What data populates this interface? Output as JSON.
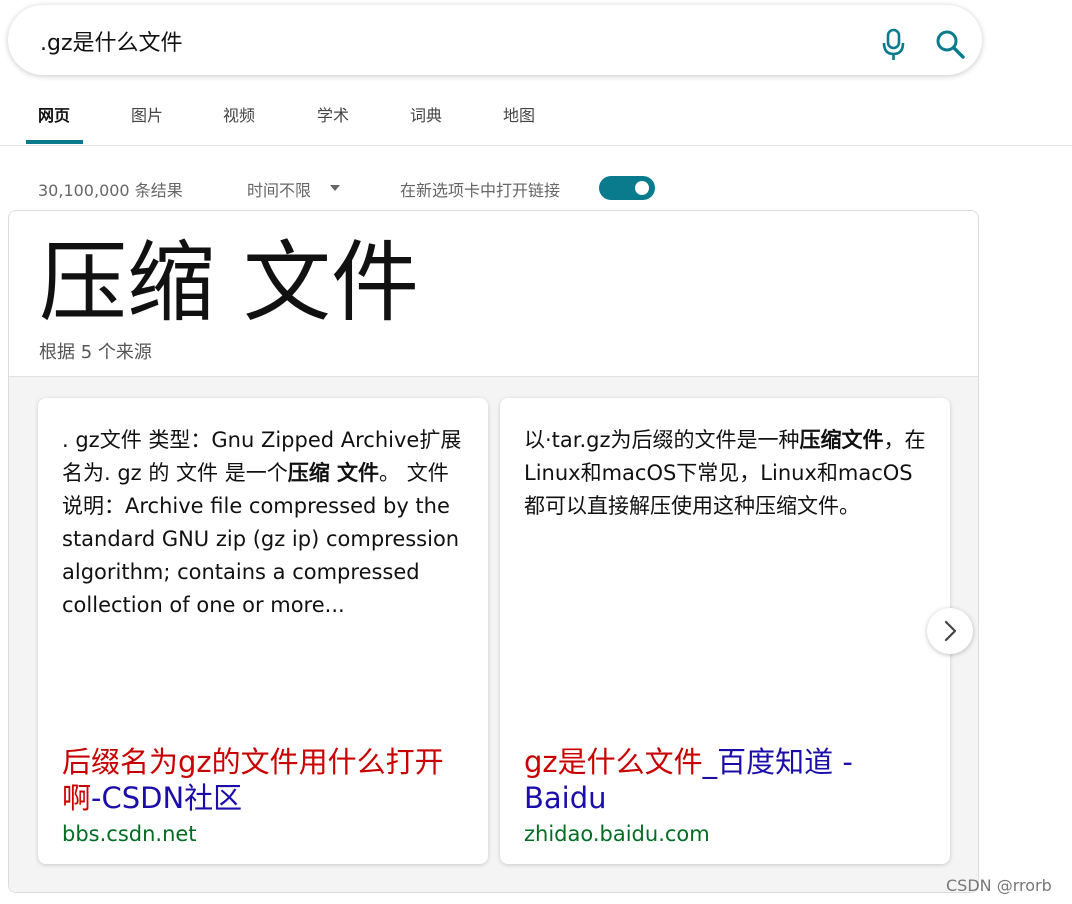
{
  "search": {
    "query": ".gz是什么文件"
  },
  "tabs": [
    {
      "label": "网页",
      "active": true
    },
    {
      "label": "图片"
    },
    {
      "label": "视频"
    },
    {
      "label": "学术"
    },
    {
      "label": "词典"
    },
    {
      "label": "地图"
    }
  ],
  "filters": {
    "result_count": "30,100,000 条结果",
    "time_filter": "时间不限",
    "open_new_tab_label": "在新选项卡中打开链接",
    "open_new_tab_enabled": true
  },
  "answer": {
    "title": "压缩 文件",
    "sources_note": "根据 5 个来源",
    "cards": [
      {
        "text_parts": [
          {
            "t": ". gz文件 类型：Gnu Zipped Archive扩展 名为. gz 的 文件 是一个",
            "bold": false
          },
          {
            "t": "压缩 文件",
            "bold": true
          },
          {
            "t": "。 文件 说明：Archive file compressed by the standard GNU zip (gz ip) compression algorithm; contains a compressed collection of one or more...",
            "bold": false
          }
        ],
        "link_red": "后缀名为gz的文件用什么打开啊",
        "link_blue": "-CSDN社区",
        "source": "bbs.csdn.net"
      },
      {
        "text_parts": [
          {
            "t": "以·tar.gz为后缀的文件是一种",
            "bold": false
          },
          {
            "t": "压缩文件",
            "bold": true
          },
          {
            "t": "，在Linux和macOS下常见，Linux和macOS都可以直接解压使用这种压缩文件。",
            "bold": false
          }
        ],
        "link_red": "gz是什么文件",
        "link_blue": "_百度知道 - Baidu",
        "source": "zhidao.baidu.com"
      }
    ]
  },
  "watermark": "CSDN @rrorb",
  "colors": {
    "accent": "#0a7b8c",
    "link_red": "#c80000",
    "link_blue": "#1a0dab",
    "source_green": "#006d21"
  },
  "icons": {
    "mic": "microphone-icon",
    "search": "search-icon",
    "next": "chevron-right-icon",
    "caret": "caret-down-icon"
  }
}
